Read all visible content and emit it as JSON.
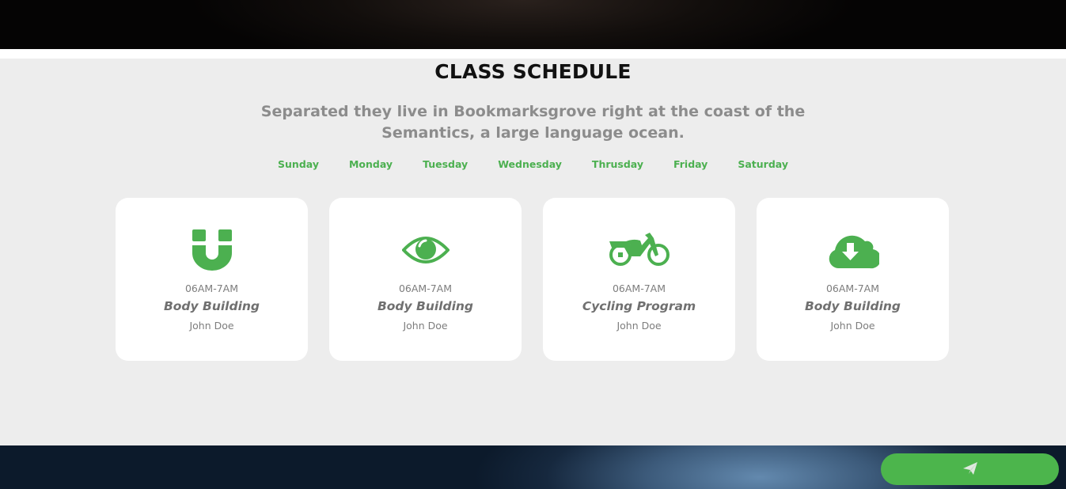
{
  "section": {
    "title": "CLASS SCHEDULE",
    "subtitle": "Separated they live in Bookmarksgrove right at the coast of the Semantics, a large language ocean."
  },
  "days": [
    "Sunday",
    "Monday",
    "Tuesday",
    "Wednesday",
    "Thrusday",
    "Friday",
    "Saturday"
  ],
  "cards": [
    {
      "icon": "magnet-icon",
      "time": "06AM-7AM",
      "class_name": "Body Building",
      "trainer": "John Doe"
    },
    {
      "icon": "eye-icon",
      "time": "06AM-7AM",
      "class_name": "Body Building",
      "trainer": "John Doe"
    },
    {
      "icon": "motorcycle-icon",
      "time": "06AM-7AM",
      "class_name": "Cycling Program",
      "trainer": "John Doe"
    },
    {
      "icon": "cloud-download-icon",
      "time": "06AM-7AM",
      "class_name": "Body Building",
      "trainer": "John Doe"
    }
  ],
  "send_button": {
    "icon": "paper-plane-icon"
  },
  "colors": {
    "accent": "#4cb050",
    "section_bg": "#ededed",
    "card_bg": "#ffffff"
  }
}
